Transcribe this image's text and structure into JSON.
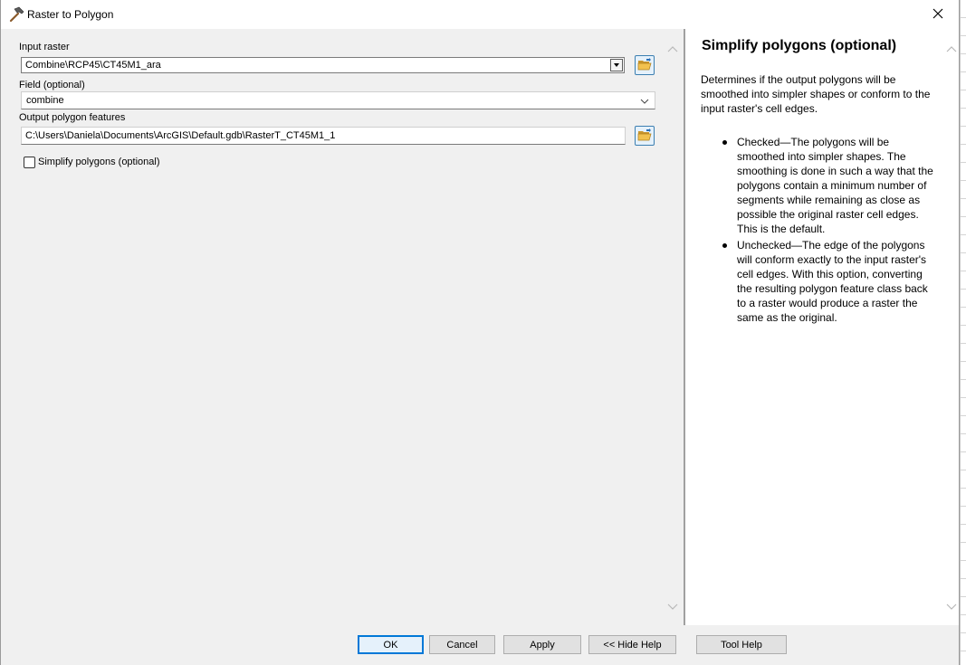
{
  "window": {
    "title": "Raster to Polygon",
    "title_icon": "hammer-icon",
    "close_icon": "close-icon"
  },
  "form": {
    "input_raster": {
      "label": "Input raster",
      "value": "Combine\\RCP45\\CT45M1_ara",
      "browse_icon": "folder-open-icon"
    },
    "field": {
      "label": "Field (optional)",
      "value": "combine"
    },
    "output": {
      "label": "Output polygon features",
      "value": "C:\\Users\\Daniela\\Documents\\ArcGIS\\Default.gdb\\RasterT_CT45M1_1",
      "browse_icon": "folder-open-icon"
    },
    "simplify": {
      "label": "Simplify polygons (optional)",
      "checked": false
    }
  },
  "help": {
    "title": "Simplify polygons (optional)",
    "description": "Determines if the output polygons will be smoothed into simpler shapes or conform to the input raster's cell edges.",
    "items": [
      "Checked—The polygons will be smoothed into simpler shapes. The smoothing is done in such a way that the polygons contain a minimum number of segments while remaining as close as possible the original raster cell edges. This is the default.",
      "Unchecked—The edge of the polygons will conform exactly to the input raster's cell edges. With this option, converting the resulting polygon feature class back to a raster would produce a raster the same as the original."
    ]
  },
  "buttons": {
    "ok": "OK",
    "cancel": "Cancel",
    "apply": "Apply",
    "hide_help": "<< Hide Help",
    "tool_help": "Tool Help"
  },
  "colors": {
    "dialog_bg": "#f0f0f0",
    "default_button_border": "#0078d7",
    "browse_button_bg": "#e5f1fb"
  }
}
